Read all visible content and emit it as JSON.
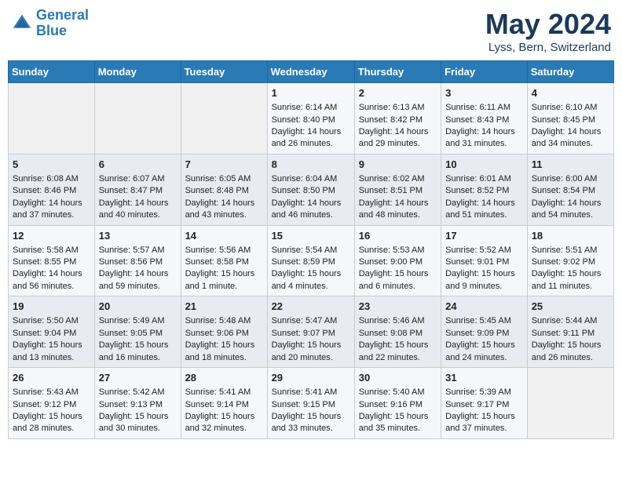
{
  "header": {
    "logo_line1": "General",
    "logo_line2": "Blue",
    "month": "May 2024",
    "location": "Lyss, Bern, Switzerland"
  },
  "weekdays": [
    "Sunday",
    "Monday",
    "Tuesday",
    "Wednesday",
    "Thursday",
    "Friday",
    "Saturday"
  ],
  "weeks": [
    [
      {
        "day": "",
        "info": ""
      },
      {
        "day": "",
        "info": ""
      },
      {
        "day": "",
        "info": ""
      },
      {
        "day": "1",
        "info": "Sunrise: 6:14 AM\nSunset: 8:40 PM\nDaylight: 14 hours\nand 26 minutes."
      },
      {
        "day": "2",
        "info": "Sunrise: 6:13 AM\nSunset: 8:42 PM\nDaylight: 14 hours\nand 29 minutes."
      },
      {
        "day": "3",
        "info": "Sunrise: 6:11 AM\nSunset: 8:43 PM\nDaylight: 14 hours\nand 31 minutes."
      },
      {
        "day": "4",
        "info": "Sunrise: 6:10 AM\nSunset: 8:45 PM\nDaylight: 14 hours\nand 34 minutes."
      }
    ],
    [
      {
        "day": "5",
        "info": "Sunrise: 6:08 AM\nSunset: 8:46 PM\nDaylight: 14 hours\nand 37 minutes."
      },
      {
        "day": "6",
        "info": "Sunrise: 6:07 AM\nSunset: 8:47 PM\nDaylight: 14 hours\nand 40 minutes."
      },
      {
        "day": "7",
        "info": "Sunrise: 6:05 AM\nSunset: 8:48 PM\nDaylight: 14 hours\nand 43 minutes."
      },
      {
        "day": "8",
        "info": "Sunrise: 6:04 AM\nSunset: 8:50 PM\nDaylight: 14 hours\nand 46 minutes."
      },
      {
        "day": "9",
        "info": "Sunrise: 6:02 AM\nSunset: 8:51 PM\nDaylight: 14 hours\nand 48 minutes."
      },
      {
        "day": "10",
        "info": "Sunrise: 6:01 AM\nSunset: 8:52 PM\nDaylight: 14 hours\nand 51 minutes."
      },
      {
        "day": "11",
        "info": "Sunrise: 6:00 AM\nSunset: 8:54 PM\nDaylight: 14 hours\nand 54 minutes."
      }
    ],
    [
      {
        "day": "12",
        "info": "Sunrise: 5:58 AM\nSunset: 8:55 PM\nDaylight: 14 hours\nand 56 minutes."
      },
      {
        "day": "13",
        "info": "Sunrise: 5:57 AM\nSunset: 8:56 PM\nDaylight: 14 hours\nand 59 minutes."
      },
      {
        "day": "14",
        "info": "Sunrise: 5:56 AM\nSunset: 8:58 PM\nDaylight: 15 hours\nand 1 minute."
      },
      {
        "day": "15",
        "info": "Sunrise: 5:54 AM\nSunset: 8:59 PM\nDaylight: 15 hours\nand 4 minutes."
      },
      {
        "day": "16",
        "info": "Sunrise: 5:53 AM\nSunset: 9:00 PM\nDaylight: 15 hours\nand 6 minutes."
      },
      {
        "day": "17",
        "info": "Sunrise: 5:52 AM\nSunset: 9:01 PM\nDaylight: 15 hours\nand 9 minutes."
      },
      {
        "day": "18",
        "info": "Sunrise: 5:51 AM\nSunset: 9:02 PM\nDaylight: 15 hours\nand 11 minutes."
      }
    ],
    [
      {
        "day": "19",
        "info": "Sunrise: 5:50 AM\nSunset: 9:04 PM\nDaylight: 15 hours\nand 13 minutes."
      },
      {
        "day": "20",
        "info": "Sunrise: 5:49 AM\nSunset: 9:05 PM\nDaylight: 15 hours\nand 16 minutes."
      },
      {
        "day": "21",
        "info": "Sunrise: 5:48 AM\nSunset: 9:06 PM\nDaylight: 15 hours\nand 18 minutes."
      },
      {
        "day": "22",
        "info": "Sunrise: 5:47 AM\nSunset: 9:07 PM\nDaylight: 15 hours\nand 20 minutes."
      },
      {
        "day": "23",
        "info": "Sunrise: 5:46 AM\nSunset: 9:08 PM\nDaylight: 15 hours\nand 22 minutes."
      },
      {
        "day": "24",
        "info": "Sunrise: 5:45 AM\nSunset: 9:09 PM\nDaylight: 15 hours\nand 24 minutes."
      },
      {
        "day": "25",
        "info": "Sunrise: 5:44 AM\nSunset: 9:11 PM\nDaylight: 15 hours\nand 26 minutes."
      }
    ],
    [
      {
        "day": "26",
        "info": "Sunrise: 5:43 AM\nSunset: 9:12 PM\nDaylight: 15 hours\nand 28 minutes."
      },
      {
        "day": "27",
        "info": "Sunrise: 5:42 AM\nSunset: 9:13 PM\nDaylight: 15 hours\nand 30 minutes."
      },
      {
        "day": "28",
        "info": "Sunrise: 5:41 AM\nSunset: 9:14 PM\nDaylight: 15 hours\nand 32 minutes."
      },
      {
        "day": "29",
        "info": "Sunrise: 5:41 AM\nSunset: 9:15 PM\nDaylight: 15 hours\nand 33 minutes."
      },
      {
        "day": "30",
        "info": "Sunrise: 5:40 AM\nSunset: 9:16 PM\nDaylight: 15 hours\nand 35 minutes."
      },
      {
        "day": "31",
        "info": "Sunrise: 5:39 AM\nSunset: 9:17 PM\nDaylight: 15 hours\nand 37 minutes."
      },
      {
        "day": "",
        "info": ""
      }
    ]
  ]
}
